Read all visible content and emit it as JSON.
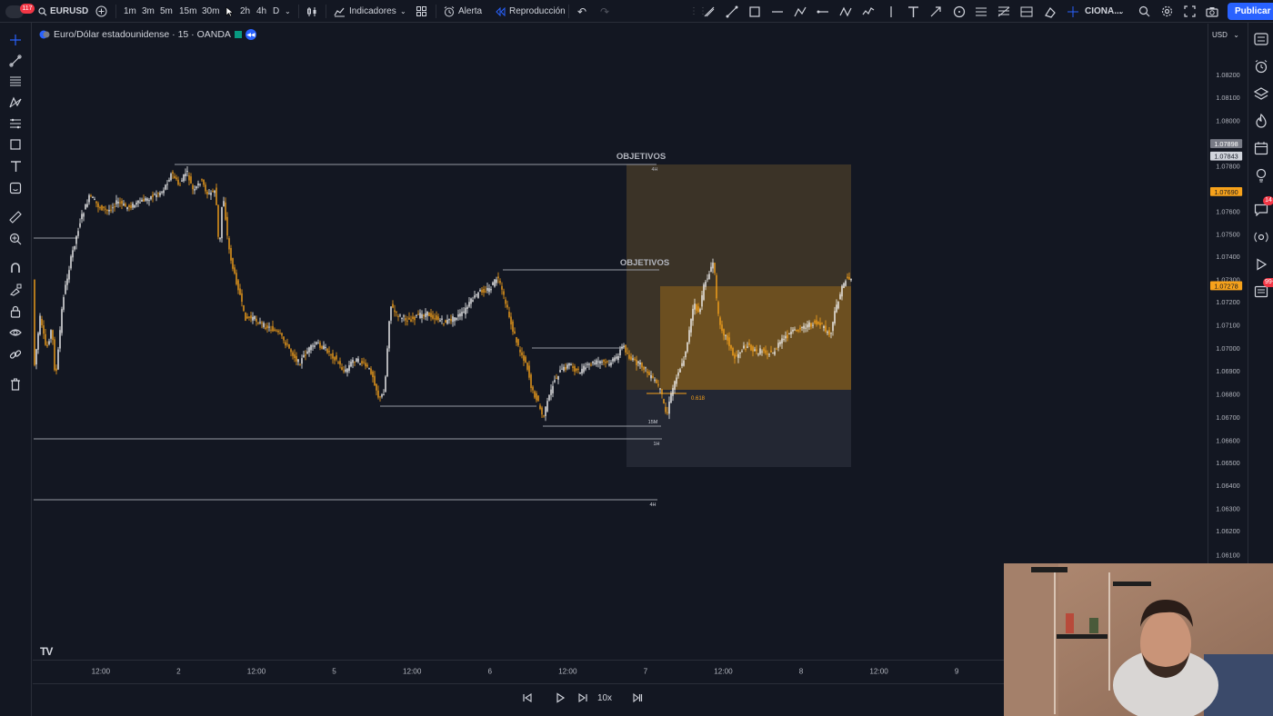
{
  "topbar": {
    "notif_count": "117",
    "symbol": "EURUSD",
    "timeframes": [
      "1m",
      "3m",
      "5m",
      "15m",
      "30m",
      "2h",
      "4h",
      "D"
    ],
    "active_timeframe": "15m",
    "indicators_label": "Indicadores",
    "alert_label": "Alerta",
    "replay_label": "Reproducción",
    "truncated_label": "CIONA...",
    "publish_label": "Publicar"
  },
  "legend": {
    "title": "Euro/Dólar estadounidense · 15 · OANDA"
  },
  "price_scale": {
    "currency": "USD",
    "ticks": [
      "1.08200",
      "1.08100",
      "1.08000",
      "1.07800",
      "1.07600",
      "1.07500",
      "1.07400",
      "1.07300",
      "1.07200",
      "1.07100",
      "1.07000",
      "1.06900",
      "1.06800",
      "1.06700",
      "1.06600",
      "1.06500",
      "1.06400",
      "1.06300",
      "1.06200",
      "1.06100"
    ],
    "labels": [
      {
        "text": "1.07898",
        "bg": "#787b86",
        "fg": "#ffffff"
      },
      {
        "text": "1.07843",
        "bg": "#d1d4dc",
        "fg": "#131722"
      },
      {
        "text": "1.07690",
        "bg": "#f7a21b",
        "fg": "#131722"
      },
      {
        "text": "1.07278",
        "bg": "#f7a21b",
        "fg": "#131722"
      }
    ]
  },
  "time_axis": {
    "ticks": [
      "12:00",
      "2",
      "12:00",
      "5",
      "12:00",
      "6",
      "12:00",
      "7",
      "12:00",
      "8",
      "12:00",
      "9"
    ]
  },
  "annotations": {
    "objetivos_1": "OBJETIVOS",
    "objetivos_2": "OBJETIVOS",
    "tf_4h_top": "4H",
    "tf_15m": "15M",
    "tf_1h": "1H",
    "tf_4h_bottom": "4H",
    "fib": "0.618"
  },
  "replay": {
    "speed": "10x"
  },
  "right_badges": {
    "messages": "14",
    "news": "99+"
  },
  "colors": {
    "accent": "#2962ff",
    "candle": "#f7a21b",
    "candle_up": "#f5f5f5",
    "zone_top": "#5c4a2b",
    "zone_mid": "#a87420",
    "zone_bottom": "#2a2e39",
    "background": "#131722"
  },
  "icons": {
    "left": [
      "crosshair-icon",
      "trendline-icon",
      "fib-retracement-icon",
      "pattern-icon",
      "projection-icon",
      "rectangle-icon",
      "text-icon",
      "sticker-icon",
      "ruler-icon",
      "zoom-icon",
      "magnet-icon",
      "lock-drawing-icon",
      "lock-icon",
      "eye-icon",
      "link-icon",
      "trash-icon"
    ],
    "right": [
      "watchlist-icon",
      "alarm-clock-icon",
      "layers-icon",
      "hotlist-icon",
      "calendar-icon",
      "ideas-icon",
      "messages-icon",
      "streams-icon",
      "play-icon",
      "news-icon"
    ]
  }
}
